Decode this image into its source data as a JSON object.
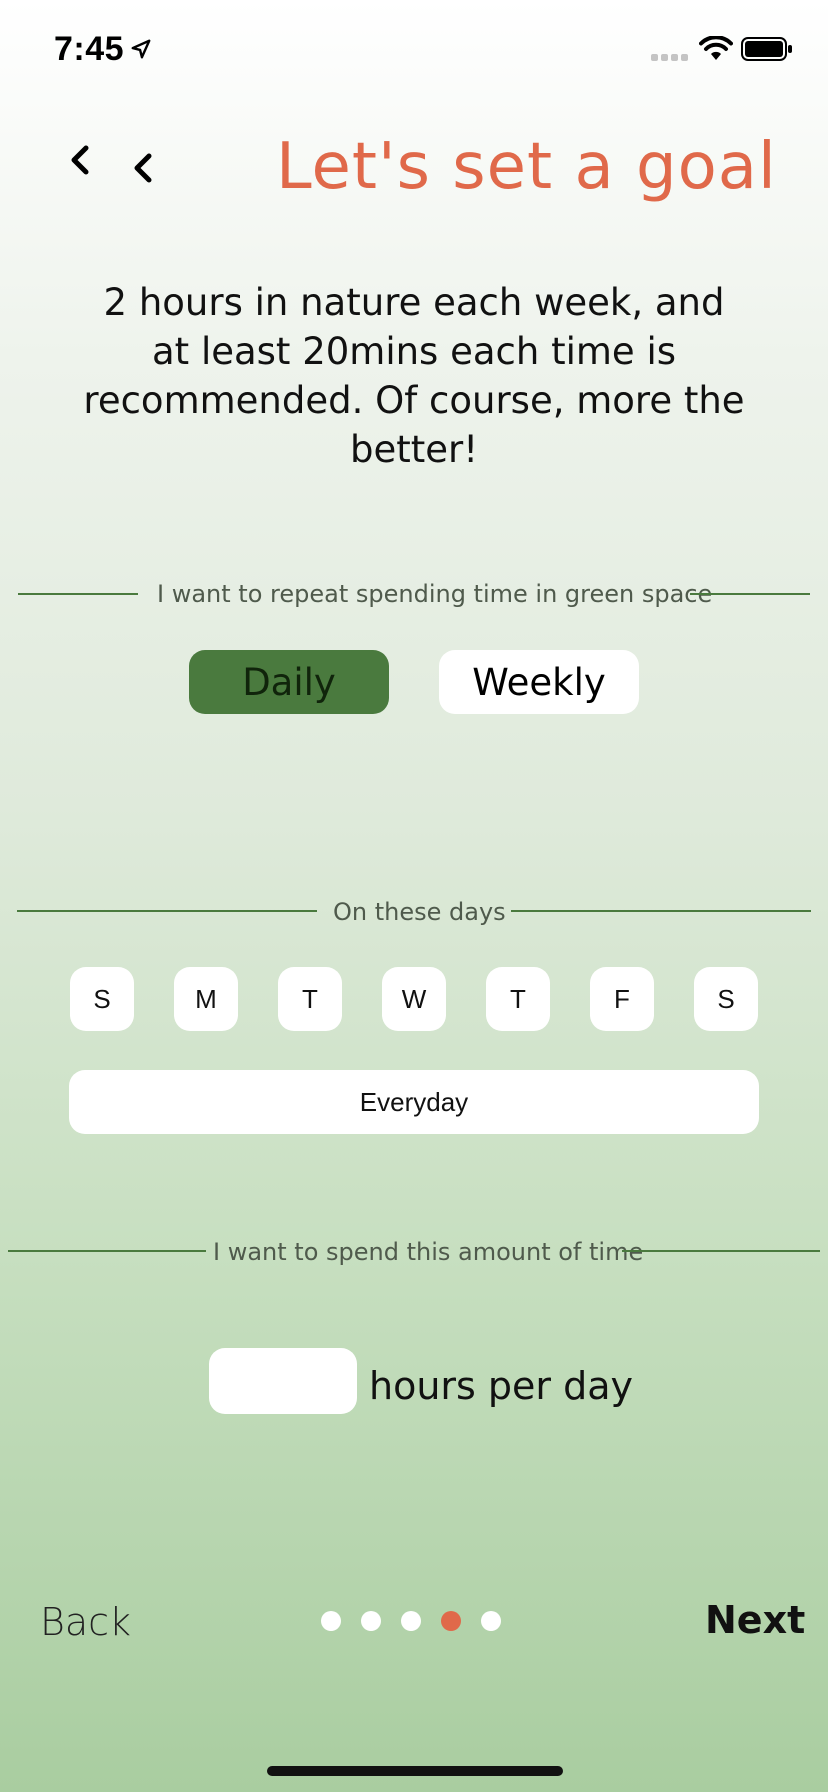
{
  "status_bar": {
    "time": "7:45",
    "icons": [
      "location-arrow-icon",
      "signal-icon",
      "wifi-icon",
      "battery-icon"
    ]
  },
  "header": {
    "title": "Let's set a goal",
    "back_icons": [
      "chevron-left-icon",
      "chevron-left-icon"
    ]
  },
  "intro_text": "2 hours in nature each week, and at least 20mins each time is recommended. Of course, more the better!",
  "repeat_section": {
    "label": "I want to repeat spending time in green space",
    "options": [
      {
        "label": "Daily",
        "selected": true
      },
      {
        "label": "Weekly",
        "selected": false
      }
    ]
  },
  "days_section": {
    "label": "On these days",
    "days": [
      "S",
      "M",
      "T",
      "W",
      "T",
      "F",
      "S"
    ],
    "everyday_label": "Everyday"
  },
  "time_section": {
    "label": "I want to spend this amount of time",
    "hours_value": "",
    "unit_label": "hours per day"
  },
  "footer": {
    "back_label": "Back",
    "next_label": "Next",
    "page_count": 5,
    "current_page": 4
  },
  "colors": {
    "accent": "#e0694a",
    "selected_green": "#4a7a3e",
    "rule_green": "#4a7a3e"
  }
}
